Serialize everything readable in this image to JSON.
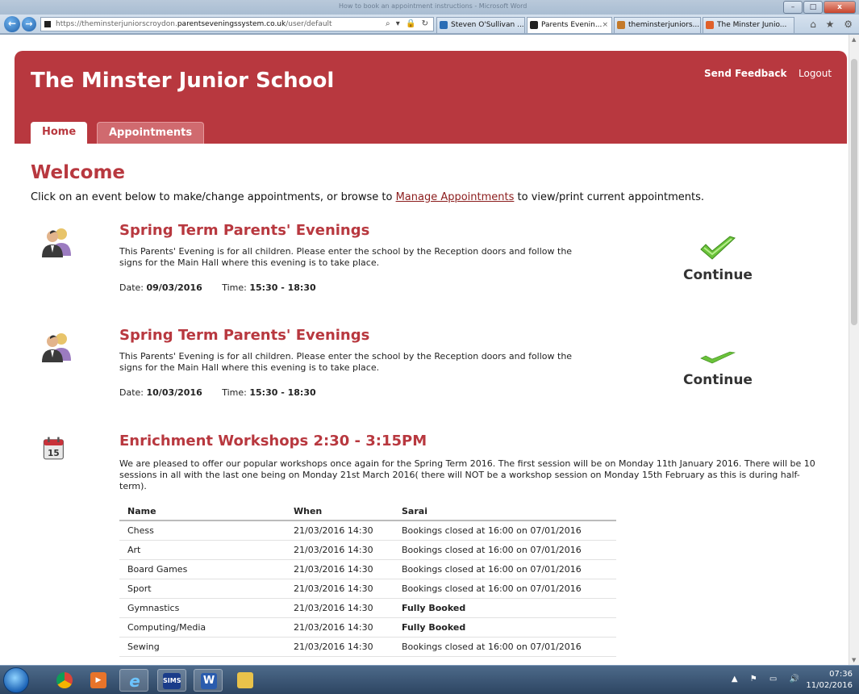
{
  "window": {
    "title": "How to book an appointment instructions - Microsoft Word"
  },
  "browser": {
    "url_prefix": "https://theminsterjuniorscroydon.",
    "url_domain": "parentseveningssystem.co.uk",
    "url_path": "/user/default",
    "address_controls": "⌕ ▾ 🔒 ↻",
    "tabs": [
      {
        "label": "Steven O'Sullivan ...",
        "color": "#2a6db5"
      },
      {
        "label": "Parents Evenin...",
        "color": "#222222"
      },
      {
        "label": "theminsterjuniors...",
        "color": "#c47a2a"
      },
      {
        "label": "The Minster Junio...",
        "color": "#e0602a"
      }
    ],
    "close_tab": "×",
    "right_icons": "⌂ ★ ⚙"
  },
  "site": {
    "title": "The Minster Junior School",
    "send_feedback": "Send Feedback",
    "logout": "Logout",
    "tabs": {
      "home": "Home",
      "appointments": "Appointments"
    },
    "brand_color": "#b8383f"
  },
  "page": {
    "heading": "Welcome",
    "intro_before": "Click on an event below to make/change appointments, or browse to ",
    "intro_link": "Manage Appointments",
    "intro_after": " to view/print current appointments."
  },
  "events": [
    {
      "title": "Spring Term Parents' Evenings",
      "description": "This Parents' Evening is for all children. Please enter the school by the Reception doors and follow the signs for the Main Hall where this evening is to take place.",
      "date_label": "Date: ",
      "date": "09/03/2016",
      "time_label": "Time: ",
      "time": "15:30 - 18:30",
      "action": "Continue"
    },
    {
      "title": "Spring Term Parents' Evenings",
      "description": "This Parents' Evening is for all children. Please enter the school by the Reception doors and follow the signs for the Main Hall where this evening is to take place.",
      "date_label": "Date: ",
      "date": "10/03/2016",
      "time_label": "Time: ",
      "time": "15:30 - 18:30",
      "action": "Continue"
    }
  ],
  "workshops": {
    "title": "Enrichment Workshops 2:30 - 3:15PM",
    "calendar_day": "15",
    "description": "We are pleased to offer our popular workshops once again for the Spring Term 2016. The first session will be on Monday 11th January 2016. There will be 10 sessions in all with the last one being on Monday 21st March 2016( there will NOT be a workshop session on Monday 15th February as this is during half-term).",
    "columns": [
      "Name",
      "When",
      "Sarai"
    ],
    "rows": [
      {
        "name": "Chess",
        "when": "21/03/2016 14:30",
        "status": "Bookings closed at 16:00 on 07/01/2016",
        "bold": false
      },
      {
        "name": "Art",
        "when": "21/03/2016 14:30",
        "status": "Bookings closed at 16:00 on 07/01/2016",
        "bold": false
      },
      {
        "name": "Board Games",
        "when": "21/03/2016 14:30",
        "status": "Bookings closed at 16:00 on 07/01/2016",
        "bold": false
      },
      {
        "name": "Sport",
        "when": "21/03/2016 14:30",
        "status": "Bookings closed at 16:00 on 07/01/2016",
        "bold": false
      },
      {
        "name": "Gymnastics",
        "when": "21/03/2016 14:30",
        "status": "Fully Booked",
        "bold": true
      },
      {
        "name": "Computing/Media",
        "when": "21/03/2016 14:30",
        "status": "Fully Booked",
        "bold": true
      },
      {
        "name": "Sewing",
        "when": "21/03/2016 14:30",
        "status": "Bookings closed at 16:00 on 07/01/2016",
        "bold": false
      }
    ]
  },
  "taskbar": {
    "sims_label": "SIMS",
    "word_label": "W",
    "tray_icons": "▲ ⚑ ▭ 🔊",
    "time": "07:36",
    "date": "11/02/2016"
  }
}
